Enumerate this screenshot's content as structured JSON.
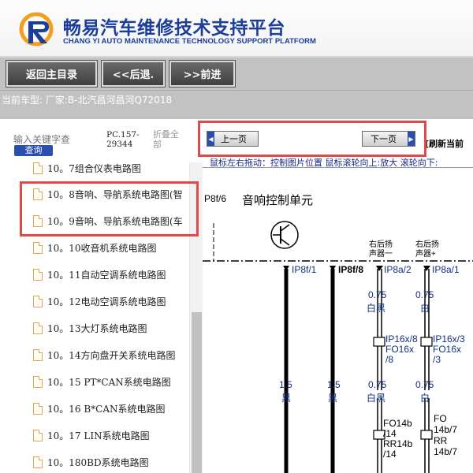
{
  "header": {
    "title_cn": "畅易汽车维修技术支持平台",
    "title_en": "CHANG YI AUTO MAINTENANCE TECHNOLOGY SUPPORT PLATFORM",
    "accent_color": "#1a3e9a"
  },
  "toolbar": {
    "home_label": "返回主目录",
    "back_label": "<<后退.",
    "forward_label": ">>前进"
  },
  "vehicle": {
    "text": "当前车型:  厂家:B-北汽昌河昌河Q72018"
  },
  "sidebar": {
    "search_placeholder": "输入关键字查",
    "search_button": "查询",
    "pc_code": "PC.157-29344",
    "collapse_label": "折叠全部",
    "items": [
      {
        "label": "10。7组合仪表电路图"
      },
      {
        "label": "10。8音响、导航系统电路图(智"
      },
      {
        "label": "10。9音响、导航系统电路图(车"
      },
      {
        "label": "10。10收音机系统电路图"
      },
      {
        "label": "10。11自动空调系统电路图"
      },
      {
        "label": "10。12电动空调系统电路图"
      },
      {
        "label": "10。13大灯系统电路图"
      },
      {
        "label": "10。14方向盘开关系统电路图"
      },
      {
        "label": "10。15 PT*CAN系统电路图"
      },
      {
        "label": "10。16 B*CAN系统电路图"
      },
      {
        "label": "10。17 LIN系统电路图"
      },
      {
        "label": "10。180BD系统电路图"
      }
    ]
  },
  "viewer": {
    "prev_label": "上一页",
    "next_label": "下一页",
    "prev_arrow": "◀",
    "next_arrow": "▶",
    "refresh_label": "[刷新当前",
    "hint": "鼠标左右拖动：控制图片位置  鼠标滚轮向上:放大  滚轮向下:"
  },
  "diagram": {
    "page_ref": "P8f/6",
    "title": "音响控制单元",
    "speaker_right_rear_minus": [
      "右后扬",
      "声器一"
    ],
    "speaker_right_rear_plus": [
      "右后扬",
      "声器+"
    ],
    "pins": [
      "IP8f/1",
      "IP8f/8",
      "IP8a/2",
      "IP8a/1"
    ],
    "wire_spec_1": "0.75",
    "wire_color_1": "白黑",
    "wire_spec_2": "0.75",
    "wire_color_2": "白",
    "connector_left": [
      "IP16x/8",
      "FO16x",
      "/8"
    ],
    "connector_right": [
      "IP16x/3",
      "FO16x",
      "/3"
    ],
    "lower_specs": [
      "1.5",
      "1.5",
      "0.75",
      "0.75"
    ],
    "lower_colors": [
      "黑",
      "黑",
      "白黑",
      "白"
    ],
    "bottom_left": [
      "FO14b",
      "/14",
      "RR14b",
      "/14"
    ],
    "bottom_right": [
      "FO",
      "14b/7",
      "RR",
      "14b/7"
    ]
  },
  "highlight_color": "#e04a4a"
}
